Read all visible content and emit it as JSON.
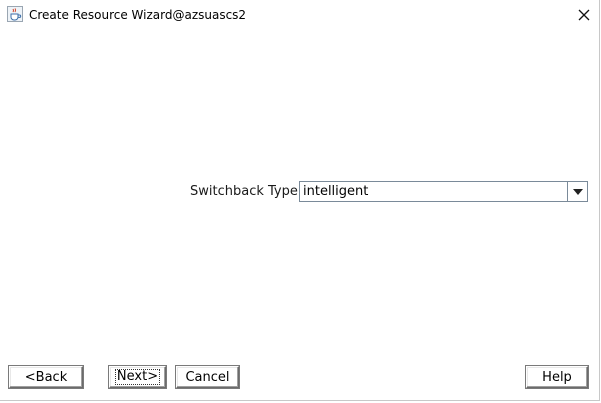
{
  "window": {
    "title": "Create Resource Wizard@azsuascs2"
  },
  "form": {
    "switchback_label": "Switchback Type",
    "switchback_value": "intelligent"
  },
  "buttons": {
    "back": "<Back",
    "next": "Next>",
    "cancel": "Cancel",
    "help": "Help"
  },
  "icons": {
    "title": "java-cup-icon",
    "close": "close-icon",
    "dropdown": "dropdown-arrow-icon"
  }
}
